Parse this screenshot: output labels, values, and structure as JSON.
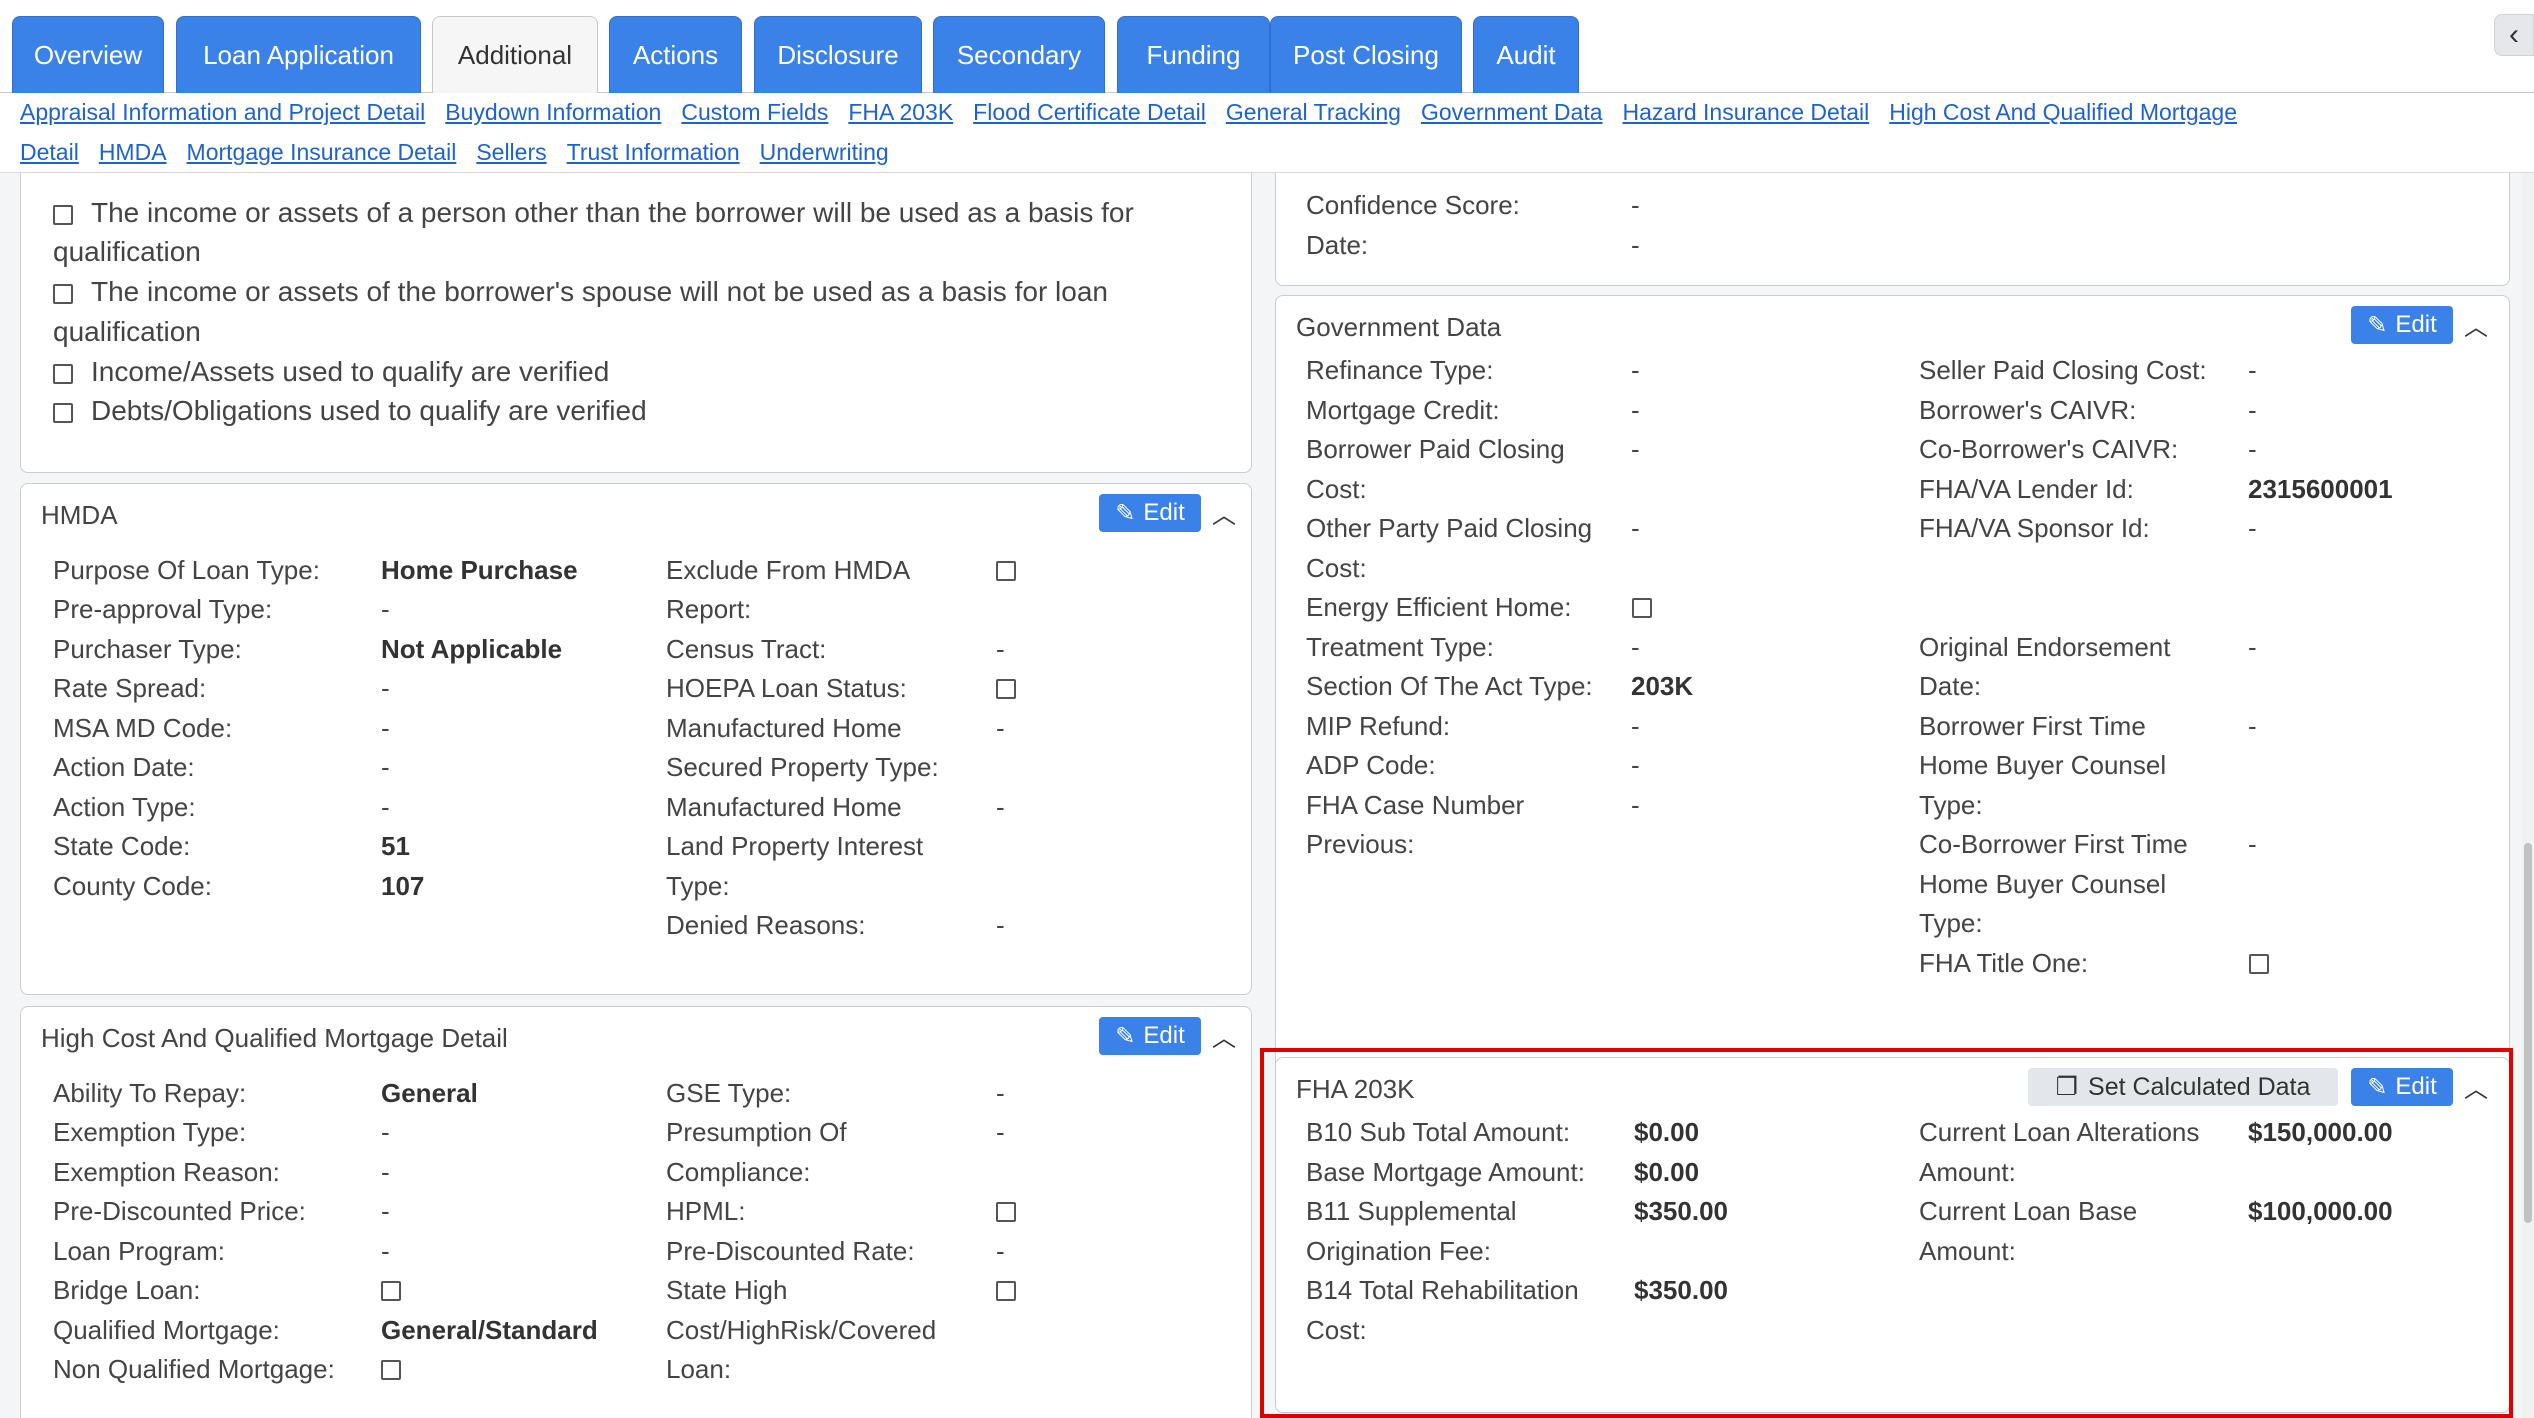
{
  "tabs": [
    "Overview",
    "Loan Application",
    "Additional",
    "Actions",
    "Disclosure",
    "Secondary",
    "Funding",
    "Post Closing",
    "Audit"
  ],
  "active_tab": "Additional",
  "links_row1": [
    "Appraisal Information and Project Detail",
    "Buydown Information",
    "Custom Fields",
    "FHA 203K",
    "Flood Certificate Detail",
    "General Tracking",
    "Government Data",
    "Hazard Insurance Detail",
    "High Cost And Qualified Mortgage"
  ],
  "links_row2": [
    "Detail",
    "HMDA",
    "Mortgage Insurance Detail",
    "Sellers",
    "Trust Information",
    "Underwriting"
  ],
  "qualification": {
    "items": [
      {
        "line1": "The income or assets of a person other than the borrower will be used as a basis for",
        "line2": "qualification"
      },
      {
        "line1": "The income or assets of the borrower's spouse will not be used as a basis for loan",
        "line2": "qualification"
      },
      {
        "line1": "Income/Assets used to qualify are verified",
        "line2": ""
      },
      {
        "line1": "Debts/Obligations used to qualify are verified",
        "line2": ""
      }
    ]
  },
  "hmda": {
    "title": "HMDA",
    "edit": "Edit",
    "left_labels": [
      "Purpose Of Loan Type:",
      "Pre-approval Type:",
      "Purchaser Type:",
      "Rate Spread:",
      "MSA MD Code:",
      "Action Date:",
      "Action Type:",
      "State Code:",
      "County Code:"
    ],
    "left_values": [
      "Home Purchase",
      "-",
      "Not Applicable",
      "-",
      "-",
      "-",
      "-",
      "51",
      "107"
    ],
    "right_labels": [
      "Exclude From HMDA",
      "Report:",
      "Census Tract:",
      "HOEPA Loan Status:",
      "Manufactured Home",
      "Secured Property Type:",
      "Manufactured Home",
      "Land Property Interest",
      "Type:",
      "Denied Reasons:"
    ],
    "right_values": {
      "census": "-",
      "mh_secured": "-",
      "mh_land": "-",
      "denied": "-"
    }
  },
  "highcost": {
    "title": "High Cost And Qualified Mortgage Detail",
    "edit": "Edit",
    "left_labels": [
      "Ability To Repay:",
      "Exemption Type:",
      "Exemption Reason:",
      "Pre-Discounted Price:",
      "Loan Program:",
      "Bridge Loan:",
      "Qualified Mortgage:",
      "Non Qualified Mortgage:"
    ],
    "left_values": {
      "ability": "General",
      "exemption_type": "-",
      "exemption_reason": "-",
      "pre_price": "-",
      "loan_program": "-",
      "qualified": "General/Standard"
    },
    "right_labels": [
      "GSE Type:",
      "Presumption Of",
      "Compliance:",
      "HPML:",
      "Pre-Discounted Rate:",
      "State High",
      "Cost/HighRisk/Covered",
      "Loan:"
    ],
    "right_values": {
      "gse": "-",
      "presumption": "-",
      "pre_rate": "-"
    }
  },
  "top_right": {
    "labels": [
      "Confidence Score:",
      "Date:"
    ],
    "values": [
      "-",
      "-"
    ]
  },
  "government": {
    "title": "Government Data",
    "edit": "Edit",
    "col1_labels": [
      "Refinance Type:",
      "Mortgage Credit:",
      "Borrower Paid Closing",
      "Cost:",
      "Other Party Paid Closing",
      "Cost:",
      "Energy Efficient Home:",
      "Treatment Type:",
      "Section Of The Act Type:",
      "MIP Refund:",
      "ADP Code:",
      "FHA Case Number",
      "Previous:"
    ],
    "col1_values": {
      "refinance": "-",
      "mortgage_credit": "-",
      "borrower_paid": "-",
      "other_party": "-",
      "treatment": "-",
      "section": "203K",
      "mip": "-",
      "adp": "-",
      "fha_case": "-"
    },
    "col2_labels": [
      "Seller Paid Closing Cost:",
      "Borrower's CAIVR:",
      "Co-Borrower's CAIVR:",
      "FHA/VA Lender Id:",
      "FHA/VA Sponsor Id:",
      "Original Endorsement",
      "Date:",
      "Borrower First Time",
      "Home Buyer Counsel",
      "Type:",
      "Co-Borrower First Time",
      "Home Buyer Counsel",
      "Type:",
      "FHA Title One:"
    ],
    "col2_values": {
      "seller_paid": "-",
      "caivr": "-",
      "co_caivr": "-",
      "lender_id": "2315600001",
      "sponsor_id": "-",
      "orig_endorse": "-",
      "bft": "-",
      "cbft": "-"
    }
  },
  "fha203k": {
    "title": "FHA 203K",
    "set_calc": "Set Calculated Data",
    "edit": "Edit",
    "col1_labels": [
      "B10 Sub Total Amount:",
      "Base Mortgage Amount:",
      "B11 Supplemental",
      "Origination Fee:",
      "B14 Total Rehabilitation",
      "Cost:"
    ],
    "col1_values": {
      "b10": "$0.00",
      "base": "$0.00",
      "b11": "$350.00",
      "b14": "$350.00"
    },
    "col2_labels": [
      "Current Loan Alterations",
      "Amount:",
      "Current Loan Base",
      "Amount:"
    ],
    "col2_values": {
      "alterations": "$150,000.00",
      "base": "$100,000.00"
    }
  }
}
